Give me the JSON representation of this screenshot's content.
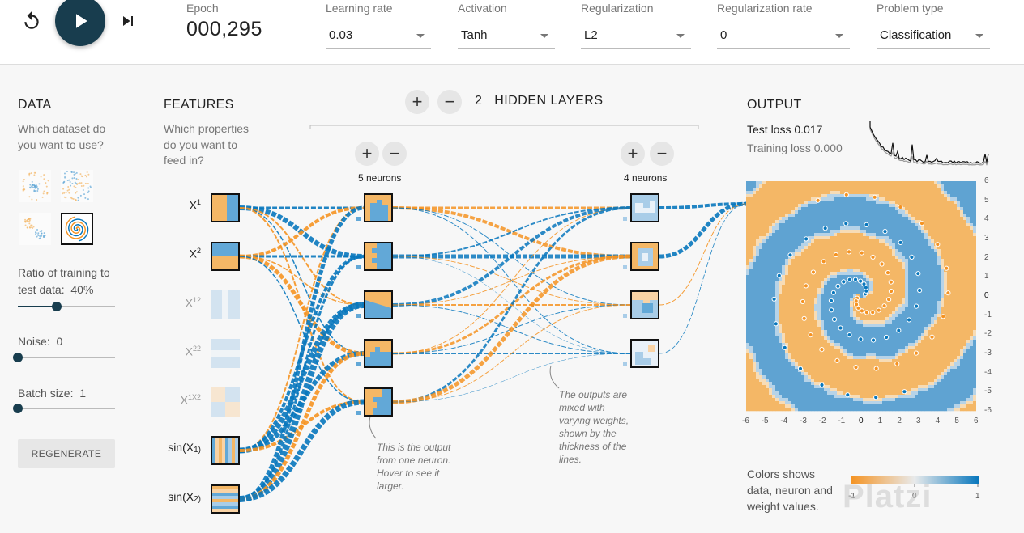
{
  "controls": {
    "reset_icon": "reset-icon",
    "play_icon": "play-icon",
    "step_icon": "step-forward-icon",
    "epoch_label": "Epoch",
    "epoch_value": "000,295",
    "learning_rate": {
      "label": "Learning rate",
      "value": "0.03"
    },
    "activation": {
      "label": "Activation",
      "value": "Tanh"
    },
    "regularization": {
      "label": "Regularization",
      "value": "L2"
    },
    "regularization_rate": {
      "label": "Regularization rate",
      "value": "0"
    },
    "problem_type": {
      "label": "Problem type",
      "value": "Classification"
    }
  },
  "data_panel": {
    "title": "DATA",
    "subtitle_1": "Which dataset do",
    "subtitle_2": "you want to use?",
    "datasets": [
      "circle",
      "xor",
      "gaussian",
      "spiral"
    ],
    "selected_dataset": "spiral",
    "ratio_label_1": "Ratio of training to",
    "ratio_label_2": "test data:",
    "ratio_value": "40%",
    "ratio_fraction": 0.4,
    "noise_label": "Noise:",
    "noise_value": "0",
    "noise_fraction": 0,
    "batch_label": "Batch size:",
    "batch_value": "1",
    "batch_fraction": 0,
    "regenerate_label": "REGENERATE"
  },
  "features_panel": {
    "title": "FEATURES",
    "subtitle_1": "Which properties",
    "subtitle_2": "do you want to",
    "subtitle_3": "feed in?",
    "features": [
      {
        "base": "X",
        "sub": "1",
        "active": true
      },
      {
        "base": "X",
        "sub": "2",
        "active": true
      },
      {
        "base": "X",
        "sub": "12",
        "active": false
      },
      {
        "base": "X",
        "sub": "22",
        "active": false
      },
      {
        "base": "X",
        "sub": "1X2",
        "active": false
      },
      {
        "base": "sin(X",
        "sub": "1)",
        "active": true
      },
      {
        "base": "sin(X",
        "sub": "2)",
        "active": true
      }
    ]
  },
  "hidden_layers": {
    "count": "2",
    "label": "HIDDEN LAYERS",
    "layer_1_neurons": "5 neurons",
    "layer_2_neurons": "4 neurons",
    "plus_icon": "plus-icon",
    "minus_icon": "minus-icon"
  },
  "notes": {
    "neuron_note_1": "This is the output",
    "neuron_note_2": "from one neuron.",
    "neuron_note_3": "Hover to see it",
    "neuron_note_4": "larger.",
    "weights_note_1": "The outputs are",
    "weights_note_2": "mixed with",
    "weights_note_3": "varying weights,",
    "weights_note_4": "shown by the",
    "weights_note_5": "thickness of the",
    "weights_note_6": "lines."
  },
  "output_panel": {
    "title": "OUTPUT",
    "test_loss": "Test loss 0.017",
    "training_loss": "Training loss 0.000",
    "x_ticks": [
      "-6",
      "-5",
      "-4",
      "-3",
      "-2",
      "-1",
      "0",
      "1",
      "2",
      "3",
      "4",
      "5",
      "6"
    ],
    "y_ticks": [
      "6",
      "5",
      "4",
      "3",
      "2",
      "1",
      "0",
      "-1",
      "-2",
      "-3",
      "-4",
      "-5",
      "-6"
    ],
    "legend_1": "Colors shows",
    "legend_2": "data, neuron and",
    "legend_3": "weight values.",
    "legend_min": "-1",
    "legend_mid": "0",
    "legend_max": "1"
  },
  "colors": {
    "orange": "#f59322",
    "blue": "#0877bd",
    "light_orange": "#f4b766",
    "light_blue": "#62a8d7",
    "dark_button": "#183d4e"
  },
  "watermark": "Platzi"
}
